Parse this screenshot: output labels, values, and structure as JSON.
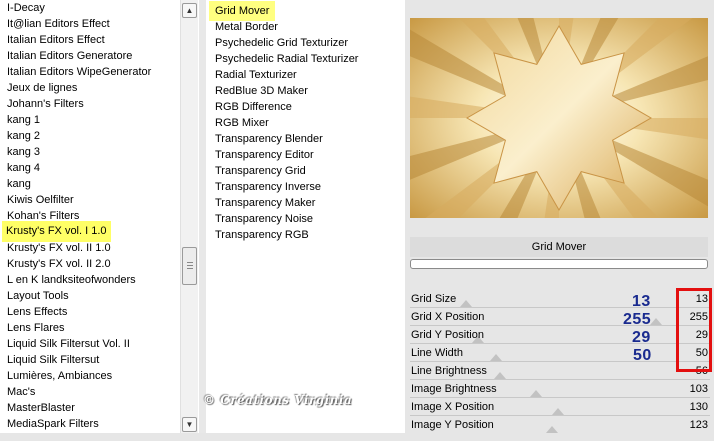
{
  "categories": [
    "I-Decay",
    "It@lian Editors Effect",
    "Italian Editors Effect",
    "Italian Editors Generatore",
    "Italian Editors WipeGenerator",
    "Jeux de lignes",
    "Johann's Filters",
    "kang 1",
    "kang 2",
    "kang 3",
    "kang 4",
    "kang",
    "Kiwis Oelfilter",
    "Kohan's Filters",
    "Krusty's FX vol. I 1.0",
    "Krusty's FX vol. II 1.0",
    "Krusty's FX vol. II 2.0",
    "L en K landksiteofwonders",
    "Layout Tools",
    "Lens Effects",
    "Lens Flares",
    "Liquid Silk Filtersut Vol. II",
    "Liquid Silk Filtersut",
    "Lumières, Ambiances",
    "Mac's",
    "MasterBlaster",
    "MediaSpark Filters"
  ],
  "selected_category": "Krusty's FX vol. I 1.0",
  "filters": [
    "Grid Mover",
    "Metal Border",
    "Psychedelic Grid Texturizer",
    "Psychedelic Radial Texturizer",
    "Radial Texturizer",
    "RedBlue 3D Maker",
    "RGB Difference",
    "RGB Mixer",
    "Transparency Blender",
    "Transparency Editor",
    "Transparency Grid",
    "Transparency Inverse",
    "Transparency Maker",
    "Transparency Noise",
    "Transparency RGB"
  ],
  "selected_filter": "Grid Mover",
  "filter_title": "Grid Mover",
  "params": [
    {
      "label": "Grid Size",
      "value": "13",
      "fraction": 0.05,
      "annotation": "13"
    },
    {
      "label": "Grid X Position",
      "value": "255",
      "fraction": 1.0,
      "annotation": "255"
    },
    {
      "label": "Grid Y Position",
      "value": "29",
      "fraction": 0.11,
      "annotation": "29"
    },
    {
      "label": "Line Width",
      "value": "50",
      "fraction": 0.2,
      "annotation": "50"
    },
    {
      "label": "Line Brightness",
      "value": "56",
      "fraction": 0.22,
      "annotation": ""
    },
    {
      "label": "Image Brightness",
      "value": "103",
      "fraction": 0.4,
      "annotation": ""
    },
    {
      "label": "Image X Position",
      "value": "130",
      "fraction": 0.51,
      "annotation": ""
    },
    {
      "label": "Image Y Position",
      "value": "123",
      "fraction": 0.48,
      "annotation": ""
    }
  ],
  "watermark": "© Créations Virginia",
  "colors": {
    "highlight": "#ffff80",
    "annotation_text": "#1a2b8f",
    "annotation_box": "#e30f0f",
    "preview_gold": "#e8c06a"
  },
  "icons": {
    "scroll_up": "chevron-up-icon",
    "scroll_down": "chevron-down-icon",
    "scroll_grip": "grip-icon"
  }
}
